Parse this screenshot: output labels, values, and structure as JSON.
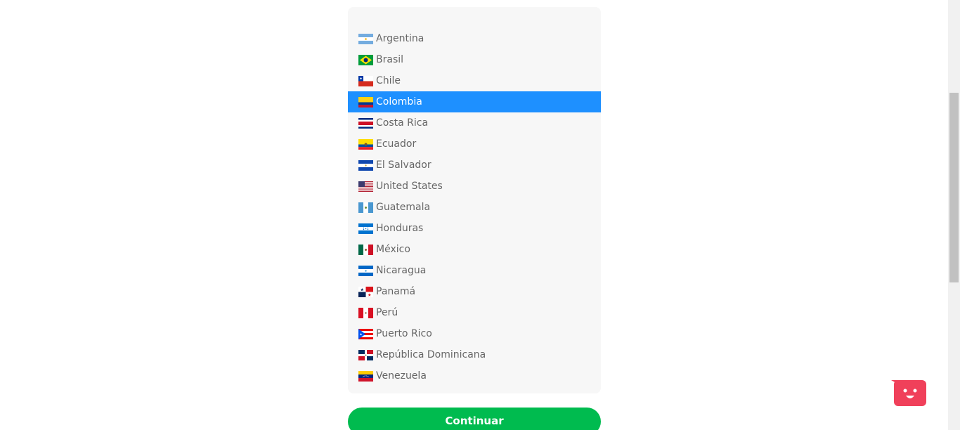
{
  "country_list": {
    "selected_index": 3,
    "items": [
      {
        "label": "Argentina",
        "flag": "flag-argentina"
      },
      {
        "label": "Brasil",
        "flag": "flag-brasil"
      },
      {
        "label": "Chile",
        "flag": "flag-chile"
      },
      {
        "label": "Colombia",
        "flag": "flag-colombia"
      },
      {
        "label": "Costa Rica",
        "flag": "flag-costa-rica"
      },
      {
        "label": "Ecuador",
        "flag": "flag-ecuador"
      },
      {
        "label": "El Salvador",
        "flag": "flag-el-salvador"
      },
      {
        "label": "United States",
        "flag": "flag-united-states"
      },
      {
        "label": "Guatemala",
        "flag": "flag-guatemala"
      },
      {
        "label": "Honduras",
        "flag": "flag-honduras"
      },
      {
        "label": "México",
        "flag": "flag-mexico"
      },
      {
        "label": "Nicaragua",
        "flag": "flag-nicaragua"
      },
      {
        "label": "Panamá",
        "flag": "flag-panama"
      },
      {
        "label": "Perú",
        "flag": "flag-peru"
      },
      {
        "label": "Puerto Rico",
        "flag": "flag-puerto-rico"
      },
      {
        "label": "República Dominicana",
        "flag": "flag-republica-dominicana"
      },
      {
        "label": "Venezuela",
        "flag": "flag-venezuela"
      }
    ]
  },
  "continue_button": {
    "label": "Continuar"
  },
  "colors": {
    "selected": "#1e90ff",
    "button": "#00bb4f",
    "chat_widget": "#f0405a"
  },
  "chat_widget": {
    "icon": "smiley-face-icon"
  }
}
